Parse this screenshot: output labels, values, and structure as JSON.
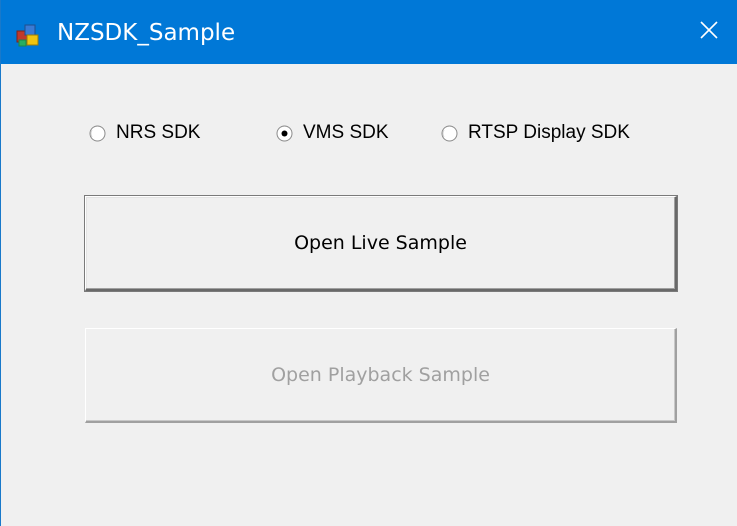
{
  "window": {
    "title": "NZSDK_Sample",
    "close_glyph": "✕"
  },
  "sdk_options": [
    {
      "label": "NRS SDK",
      "checked": false
    },
    {
      "label": "VMS SDK",
      "checked": true
    },
    {
      "label": "RTSP Display SDK",
      "checked": false
    }
  ],
  "buttons": {
    "live_label": "Open Live Sample",
    "playback_label": "Open Playback Sample",
    "playback_enabled": false
  },
  "colors": {
    "titlebar": "#0078d7",
    "background": "#f0f0f0",
    "disabled_text": "#a0a0a0"
  },
  "icons": {
    "app": "app-window-icon",
    "close": "close-icon"
  }
}
